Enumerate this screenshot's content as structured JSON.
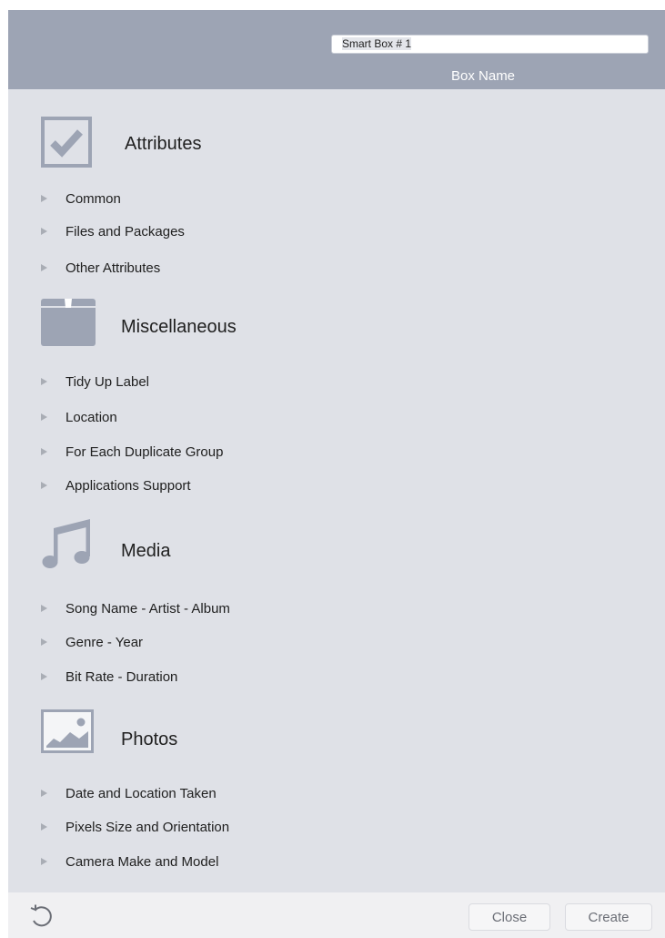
{
  "header": {
    "box_name_value": "Smart Box # 1",
    "box_name_label": "Box Name"
  },
  "sections": {
    "attributes": {
      "title": "Attributes",
      "icon": "checkbox-checked-icon",
      "items": [
        "Common",
        "Files and Packages",
        "Other Attributes"
      ]
    },
    "miscellaneous": {
      "title": "Miscellaneous",
      "icon": "box-icon",
      "items": [
        "Tidy Up Label",
        "Location",
        "For Each Duplicate Group",
        "Applications Support"
      ]
    },
    "media": {
      "title": "Media",
      "icon": "music-note-icon",
      "items": [
        "Song Name - Artist - Album",
        "Genre - Year",
        "Bit Rate - Duration"
      ]
    },
    "photos": {
      "title": "Photos",
      "icon": "photo-icon",
      "items": [
        "Date and Location Taken",
        "Pixels Size and Orientation",
        "Camera Make and Model"
      ]
    }
  },
  "footer": {
    "close_label": "Close",
    "create_label": "Create",
    "revert_icon": "revert-icon"
  },
  "colors": {
    "header_bg": "#9da4b4",
    "content_bg": "#dfe1e7",
    "icon_gray": "#9da4b4",
    "disclosure_triangle": "#a9adb5"
  }
}
